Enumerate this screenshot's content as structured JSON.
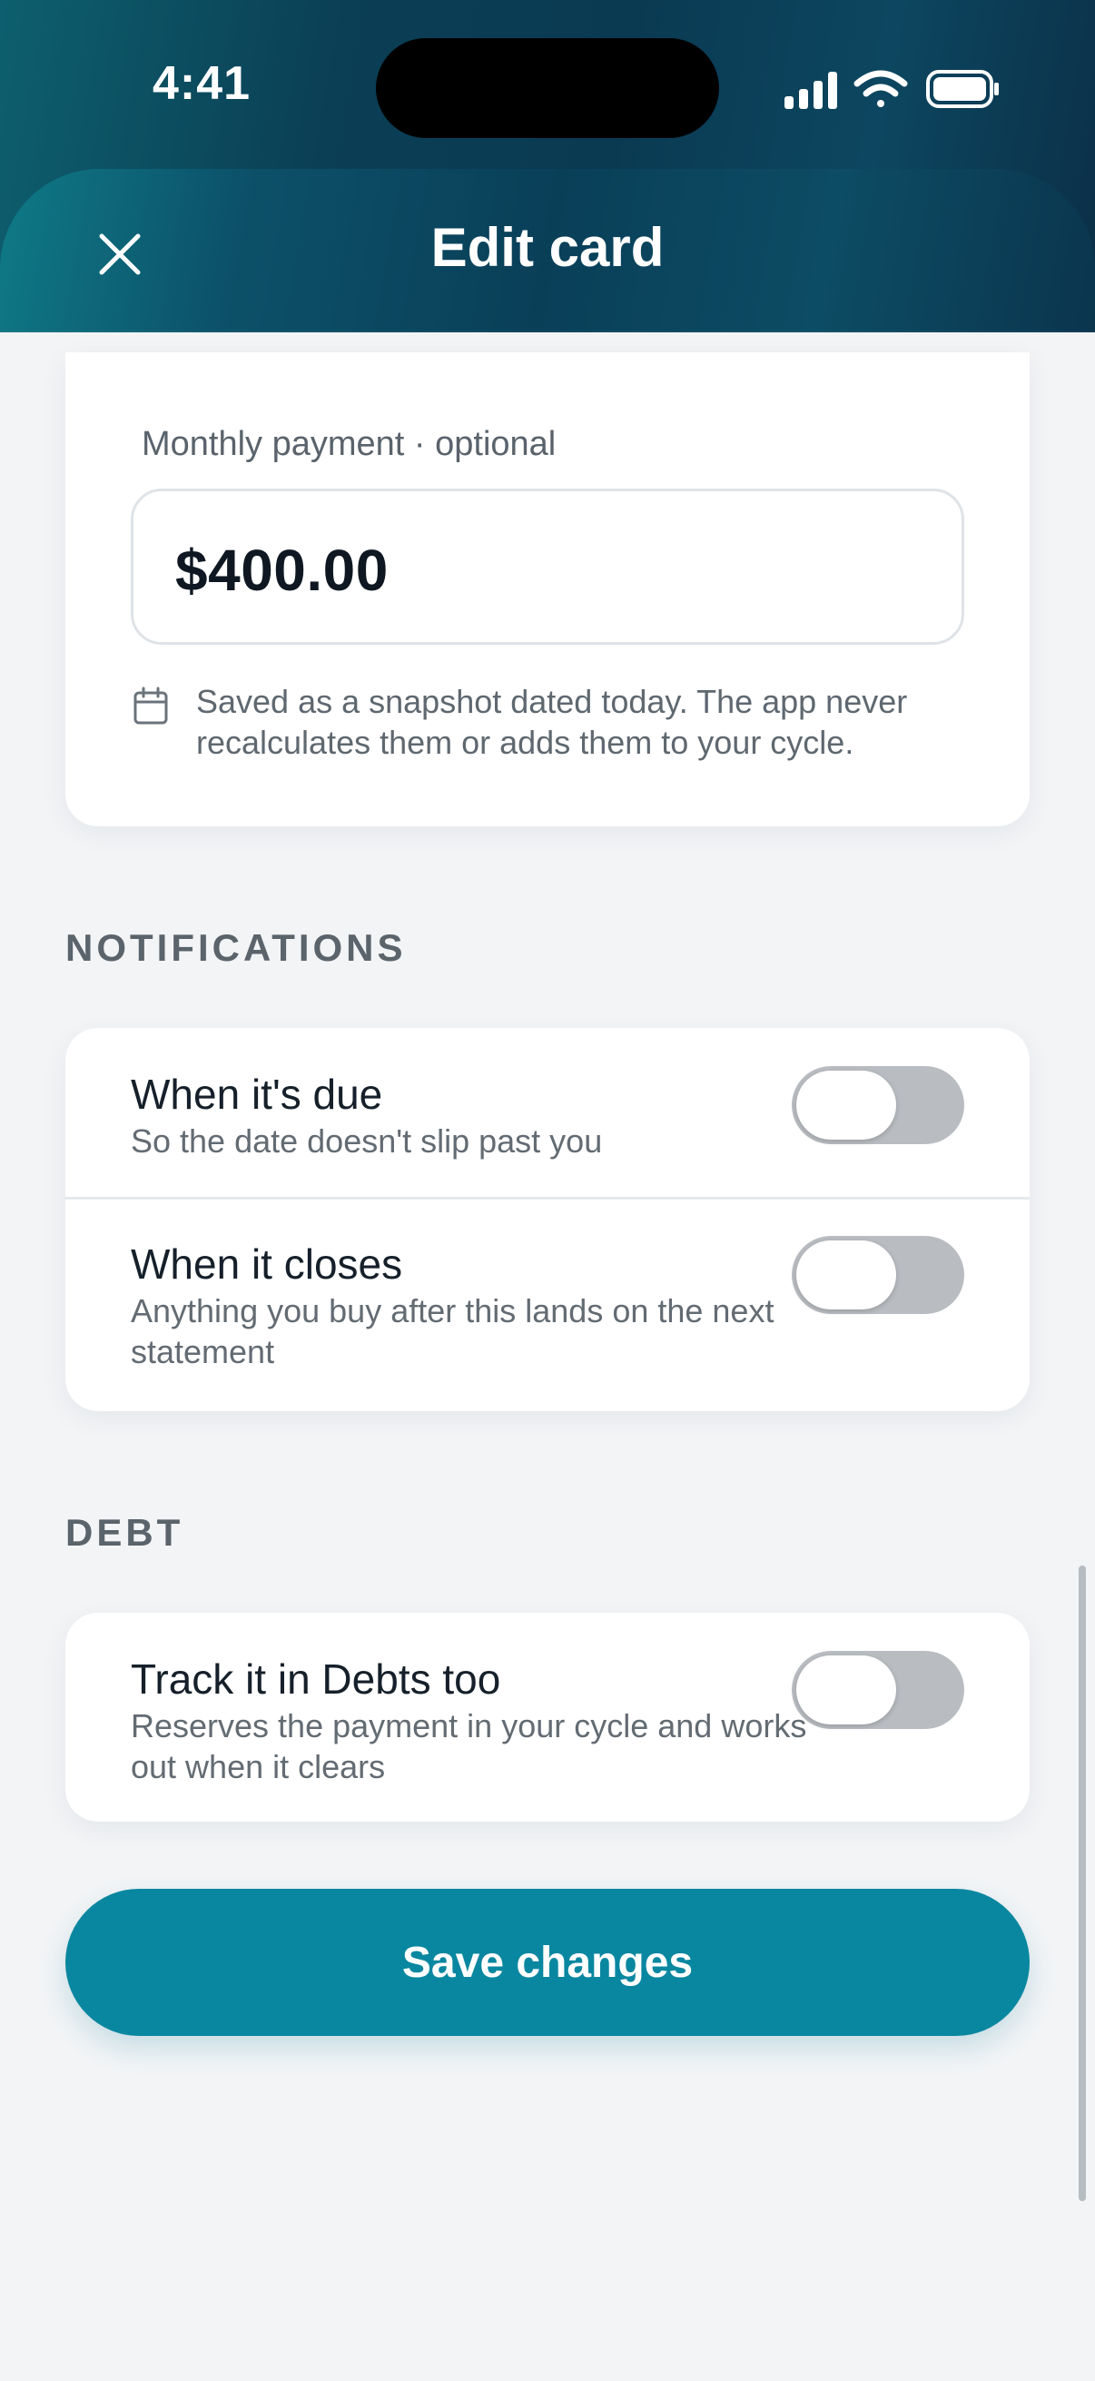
{
  "status_bar": {
    "time": "4:41"
  },
  "nav": {
    "title": "Edit card",
    "close_icon": "close-icon"
  },
  "payment": {
    "label": "Monthly payment · optional",
    "value": "$400.00",
    "hint_icon": "calendar-icon",
    "hint": "Saved as a snapshot dated today. The app never recalculates them or adds them to your cycle."
  },
  "notifications": {
    "section_title": "NOTIFICATIONS",
    "items": [
      {
        "title": "When it's due",
        "subtitle": "So the date doesn't slip past you",
        "enabled": false
      },
      {
        "title": "When it closes",
        "subtitle": "Anything you buy after this lands on the next statement",
        "enabled": false
      }
    ]
  },
  "debt": {
    "section_title": "DEBT",
    "item": {
      "title": "Track it in Debts too",
      "subtitle": "Reserves the payment in your cycle and works out when it clears",
      "enabled": false
    }
  },
  "actions": {
    "save_label": "Save changes"
  },
  "colors": {
    "accent": "#0a87a0",
    "header": "#0a3f58",
    "toggle_off": "#b9bdc2"
  }
}
